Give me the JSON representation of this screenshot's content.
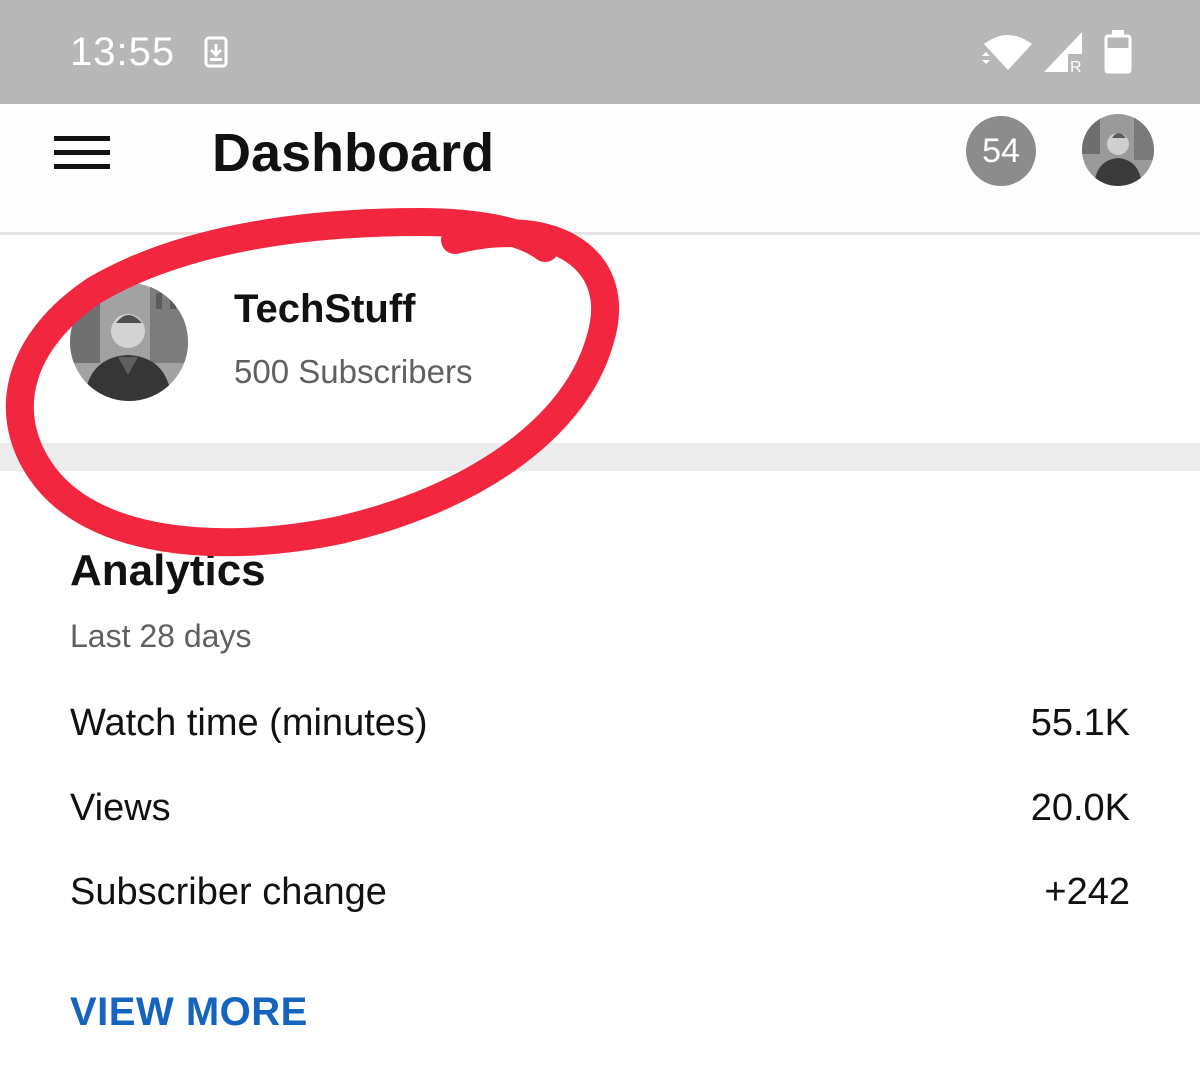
{
  "status_bar": {
    "time": "13:55",
    "icons": [
      "download-icon",
      "wifi-icon",
      "cell-signal-roaming-icon",
      "battery-icon"
    ],
    "roaming_label": "R"
  },
  "app_bar": {
    "title": "Dashboard",
    "notification_count": "54",
    "menu_icon": "hamburger-menu-icon"
  },
  "channel": {
    "name": "TechStuff",
    "subscribers": "500 Subscribers"
  },
  "analytics": {
    "title": "Analytics",
    "period": "Last 28 days",
    "metrics": [
      {
        "label": "Watch time (minutes)",
        "value": "55.1K"
      },
      {
        "label": "Views",
        "value": "20.0K"
      },
      {
        "label": "Subscriber change",
        "value": "+242"
      }
    ],
    "view_more": "VIEW MORE"
  },
  "colors": {
    "status_bar": "#b7b7b7",
    "badge": "#8c8c8c",
    "link": "#1565c0",
    "annotation": "#f2263f",
    "divider": "#ececec"
  }
}
